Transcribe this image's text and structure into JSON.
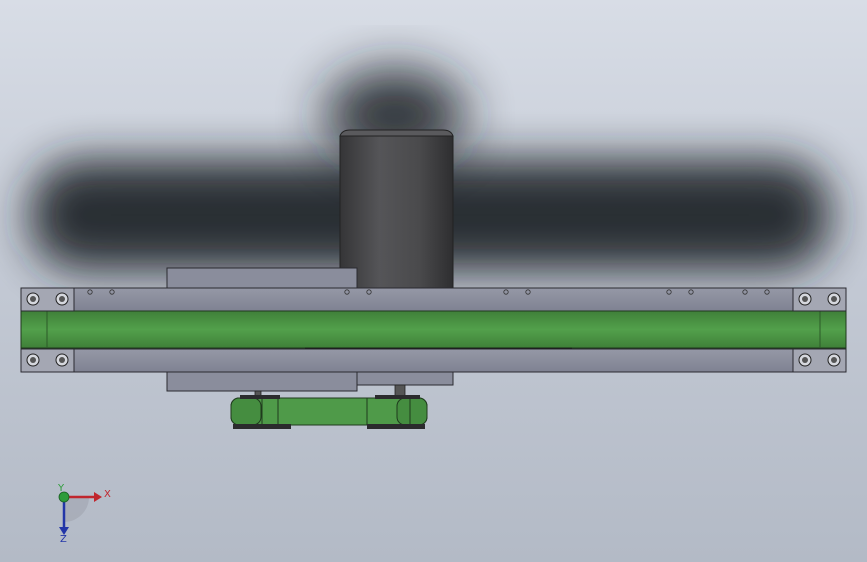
{
  "colors": {
    "background_top": "#d8dde6",
    "background_bottom": "#b3bac6",
    "frame": "#8a8d9c",
    "belt": "#4f9a49",
    "belt_dark": "#3e7e39",
    "motor": "#4a4a4c",
    "shadow": "#1e2126",
    "axis_x": "#c0262d",
    "axis_y": "#2e9c3a",
    "axis_z": "#2336a8"
  },
  "triad": {
    "x_label": "X",
    "y_label": "Y",
    "z_label": "Z"
  },
  "icons": [
    "coordinate-triad-icon"
  ]
}
